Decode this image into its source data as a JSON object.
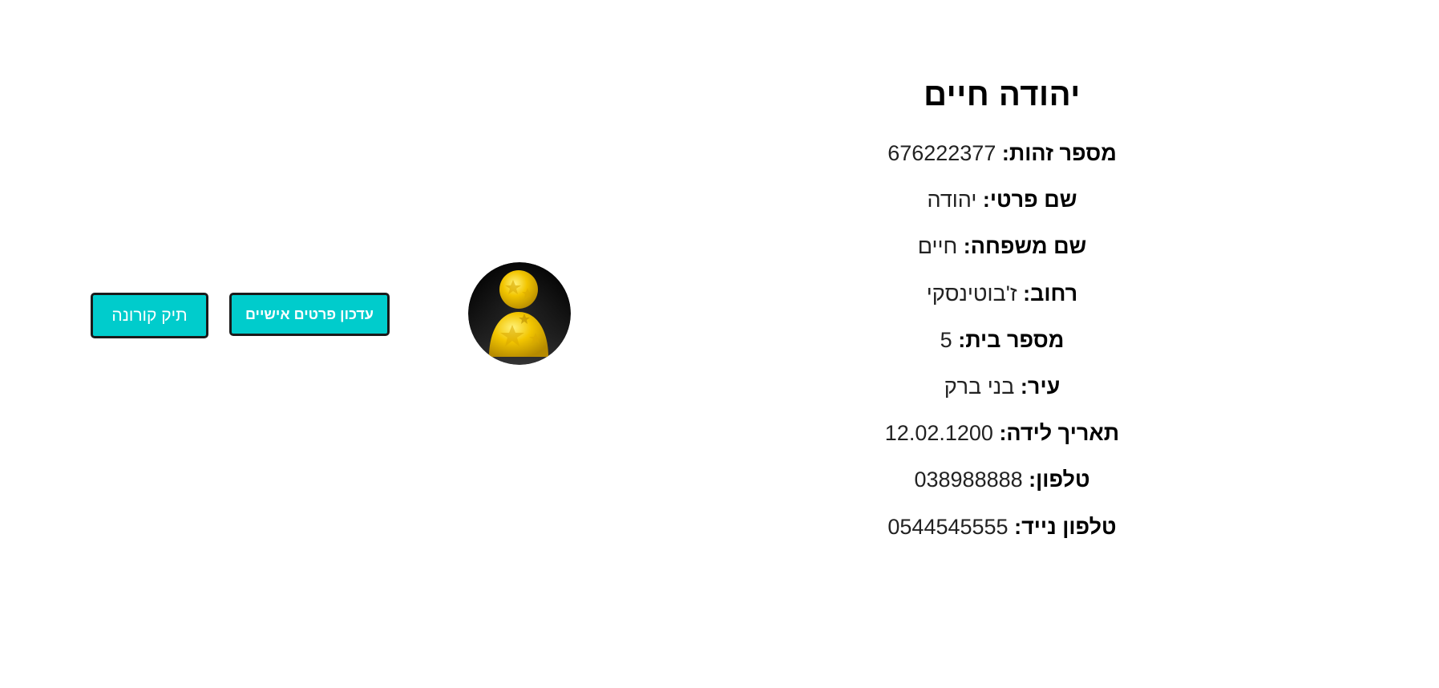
{
  "profile": {
    "full_name": "יהודה חיים",
    "fields": [
      {
        "label": "מספר זהות:",
        "value": "676222377"
      },
      {
        "label": "שם פרטי:",
        "value": "יהודה"
      },
      {
        "label": "שם משפחה:",
        "value": "חיים"
      },
      {
        "label": "רחוב:",
        "value": "ז'בוטינסקי"
      },
      {
        "label": "מספר בית:",
        "value": "5"
      },
      {
        "label": "עיר:",
        "value": "בני ברק"
      },
      {
        "label": "תאריך לידה:",
        "value": "12.02.1200"
      },
      {
        "label": "טלפון:",
        "value": "038988888"
      },
      {
        "label": "טלפון נייד:",
        "value": "0544545555"
      }
    ]
  },
  "avatar": {
    "icon": "user-avatar-icon",
    "colors": {
      "background": "#000000",
      "figure": "#f2c500",
      "accent": "#c9a100"
    }
  },
  "actions": {
    "update_details_label": "עדכון פרטים אישיים",
    "corona_file_label": "תיק קורונה",
    "button_color": "#00cccc",
    "button_border": "#1a1a1a"
  }
}
